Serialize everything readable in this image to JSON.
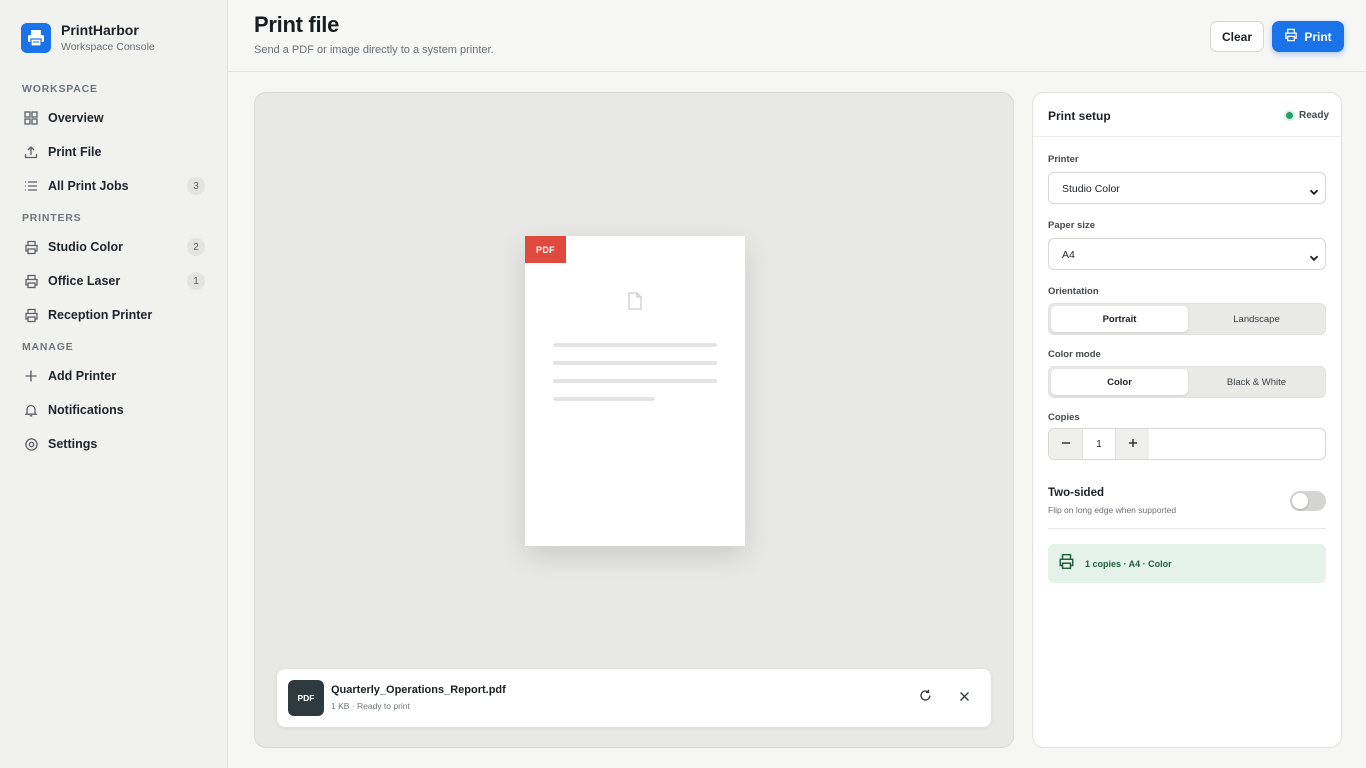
{
  "app": {
    "name": "PrintHarbor",
    "subtitle": "Workspace Console"
  },
  "sidebar": {
    "sections": [
      {
        "label": "WORKSPACE"
      },
      {
        "label": "PRINTERS"
      },
      {
        "label": "MANAGE"
      }
    ],
    "items": [
      {
        "label": "Overview",
        "icon": "grid-icon"
      },
      {
        "label": "Print File",
        "icon": "upload-icon"
      },
      {
        "label": "All Print Jobs",
        "icon": "list-icon",
        "badge": "3"
      },
      {
        "label": "Studio Color",
        "icon": "printer-icon",
        "badge": "2"
      },
      {
        "label": "Office Laser",
        "icon": "printer-icon",
        "badge": "1"
      },
      {
        "label": "Reception Printer",
        "icon": "printer-icon"
      },
      {
        "label": "Add Printer",
        "icon": "plus-icon"
      },
      {
        "label": "Notifications",
        "icon": "bell-icon"
      },
      {
        "label": "Settings",
        "icon": "gear-icon"
      }
    ]
  },
  "header": {
    "title": "Print file",
    "subtitle": "Send a PDF or image directly to a system printer.",
    "clear_label": "Clear",
    "print_label": "Print"
  },
  "preview": {
    "doc_tag": "PDF",
    "file": {
      "thumb_label": "PDF",
      "name": "Quarterly_Operations_Report.pdf",
      "meta": "1 KB · Ready to print"
    }
  },
  "setup": {
    "title": "Print setup",
    "status": "Ready",
    "printer": {
      "label": "Printer",
      "value": "Studio Color"
    },
    "paper": {
      "label": "Paper size",
      "value": "A4"
    },
    "orientation": {
      "label": "Orientation",
      "options": [
        "Portrait",
        "Landscape"
      ],
      "selected": "Portrait"
    },
    "color_mode": {
      "label": "Color mode",
      "options": [
        "Color",
        "Black & White"
      ],
      "selected": "Color"
    },
    "copies": {
      "label": "Copies",
      "value": "1"
    },
    "two_sided": {
      "title": "Two-sided",
      "subtitle": "Flip on long edge when supported",
      "enabled": false
    },
    "summary": "1 copies · A4 · Color"
  },
  "colors": {
    "accent": "#1a73e8",
    "pdf_red": "#df4a3f",
    "ready_green": "#22a06b",
    "summary_bg": "#e5f2ea"
  }
}
